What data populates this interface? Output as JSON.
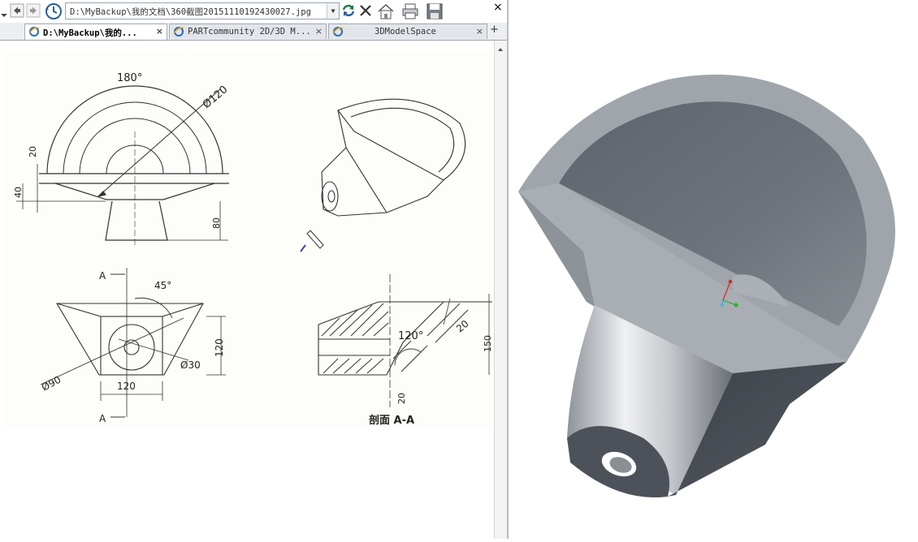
{
  "address_bar": {
    "url": "D:\\MyBackup\\我的文档\\360截图20151110192430027.jpg"
  },
  "tabs": [
    {
      "label": "D:\\MyBackup\\我的...",
      "active": true
    },
    {
      "label": "PARTcommunity 2D/3D M...",
      "active": false
    },
    {
      "label": "3DModelSpace",
      "active": false
    }
  ],
  "toolbar": {
    "icons": [
      "dropdown-arrow",
      "back-arrow",
      "forward-arrow",
      "history-clock",
      "refresh-arrows",
      "stop-x",
      "home",
      "print",
      "save"
    ],
    "close_label": "×",
    "new_tab_label": "+",
    "tab_close_label": "×"
  },
  "drawing": {
    "dim_180": "180°",
    "dim_d120": "Ø120",
    "dim_20": "20",
    "dim_40": "40",
    "dim_80": "80",
    "section_a": "A",
    "dim_45": "45°",
    "dim_120_right": "120",
    "dim_d30": "Ø30",
    "dim_d90": "Ø90",
    "dim_120_bottom": "120",
    "dim_120deg": "120°",
    "dim_20_sec": "20",
    "dim_20_vert": "20",
    "dim_150": "150",
    "section_label": "剖面 A-A"
  },
  "colors": {
    "model_face": "#9aa0a8",
    "model_top": "#a3a8ae",
    "model_dark": "#4a4f57",
    "tab_active": "#ffffff"
  }
}
